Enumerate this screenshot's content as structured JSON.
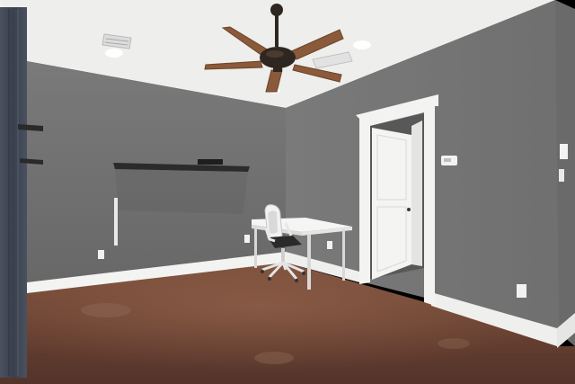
{
  "scene": {
    "description_tags": [
      "interior-room",
      "ceiling-fan",
      "desk",
      "office-chair",
      "door",
      "floating-shelves"
    ]
  },
  "colors": {
    "ceiling": "#f2f2f0",
    "wall_left": "#6b6b6b",
    "wall_back": "#707070",
    "wall_right": "#787878",
    "floor": "#6a4232",
    "trim": "#f4f4f2",
    "fan_blade": "#8a5a3a",
    "shelf": "#2a2a2a",
    "curtain": "#3e4552"
  }
}
